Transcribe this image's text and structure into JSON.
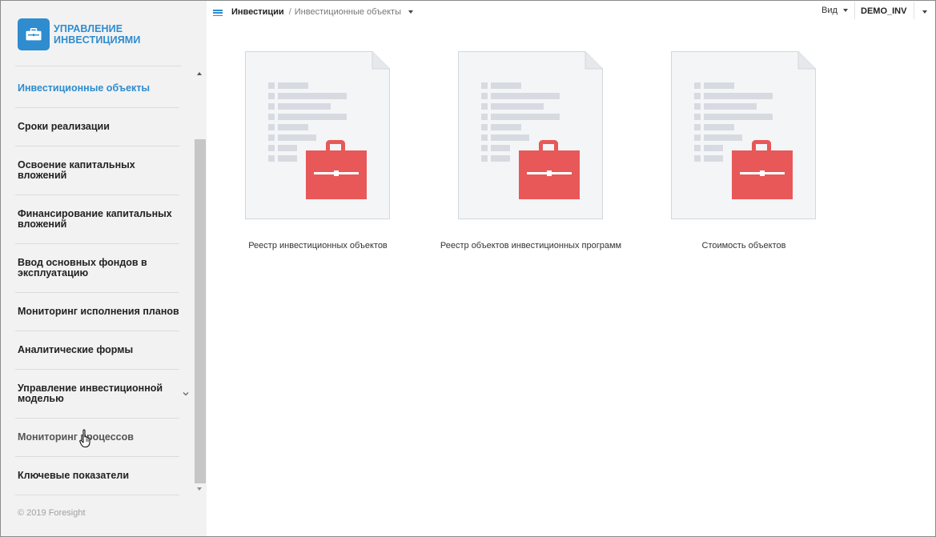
{
  "app": {
    "logo_line1": "УПРАВЛЕНИЕ",
    "logo_line2": "ИНВЕСТИЦИЯМИ",
    "brand_color": "#2e8ccf",
    "accent_color": "#e85858"
  },
  "sidebar": {
    "items": [
      {
        "label": "Инвестиционные объекты",
        "state": "active"
      },
      {
        "label": "Сроки реализации"
      },
      {
        "label": "Освоение капитальных вложений"
      },
      {
        "label": "Финансирование капитальных вложений"
      },
      {
        "label": "Ввод основных фондов в эксплуатацию"
      },
      {
        "label": "Мониторинг исполнения планов"
      },
      {
        "label": "Аналитические формы"
      },
      {
        "label": "Управление инвестиционной моделью",
        "expandable": true
      },
      {
        "label": "Мониторинг процессов",
        "state": "hover"
      },
      {
        "label": "Ключевые показатели"
      }
    ],
    "copyright": "© 2019 Foresight"
  },
  "header": {
    "breadcrumb_root": "Инвестиции",
    "breadcrumb_sep": "/",
    "breadcrumb_current": "Инвестиционные объекты",
    "view_label": "Вид",
    "user_name": "DEMO_INV"
  },
  "cards": [
    {
      "caption": "Реестр инвестиционных объектов",
      "icon": "briefcase-document-icon"
    },
    {
      "caption": "Реестр объектов инвестиционных программ",
      "icon": "briefcase-document-icon"
    },
    {
      "caption": "Стоимость объектов",
      "icon": "briefcase-document-icon"
    }
  ]
}
